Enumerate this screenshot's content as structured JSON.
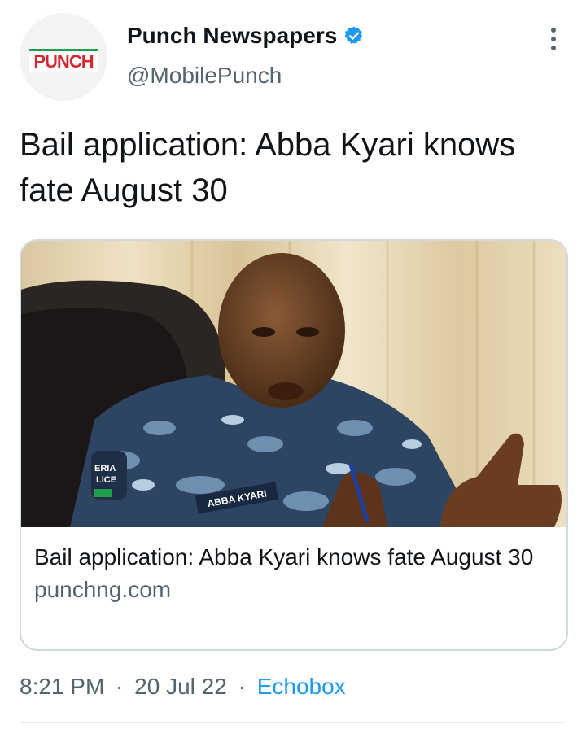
{
  "account": {
    "display_name": "Punch Newspapers",
    "handle": "@MobilePunch",
    "verified": true,
    "verified_icon": "verified-badge-icon",
    "avatar_text": "PUNCH"
  },
  "tweet": {
    "text": "Bail application: Abba Kyari knows fate August 30"
  },
  "card": {
    "image_alt": "Abba Kyari in police uniform",
    "uniform_tag": "ABBA KYARI",
    "badge_text_1": "ERIA",
    "badge_text_2": "LICE",
    "title": "Bail application: Abba Kyari knows fate August 30",
    "domain": "punchng.com"
  },
  "meta": {
    "time": "8:21 PM",
    "date": "20 Jul 22",
    "source": "Echobox",
    "separator": "·"
  },
  "colors": {
    "link": "#1d9bf0",
    "secondary_text": "#536471",
    "border": "#cfd9de",
    "punch_red": "#d6282f"
  }
}
